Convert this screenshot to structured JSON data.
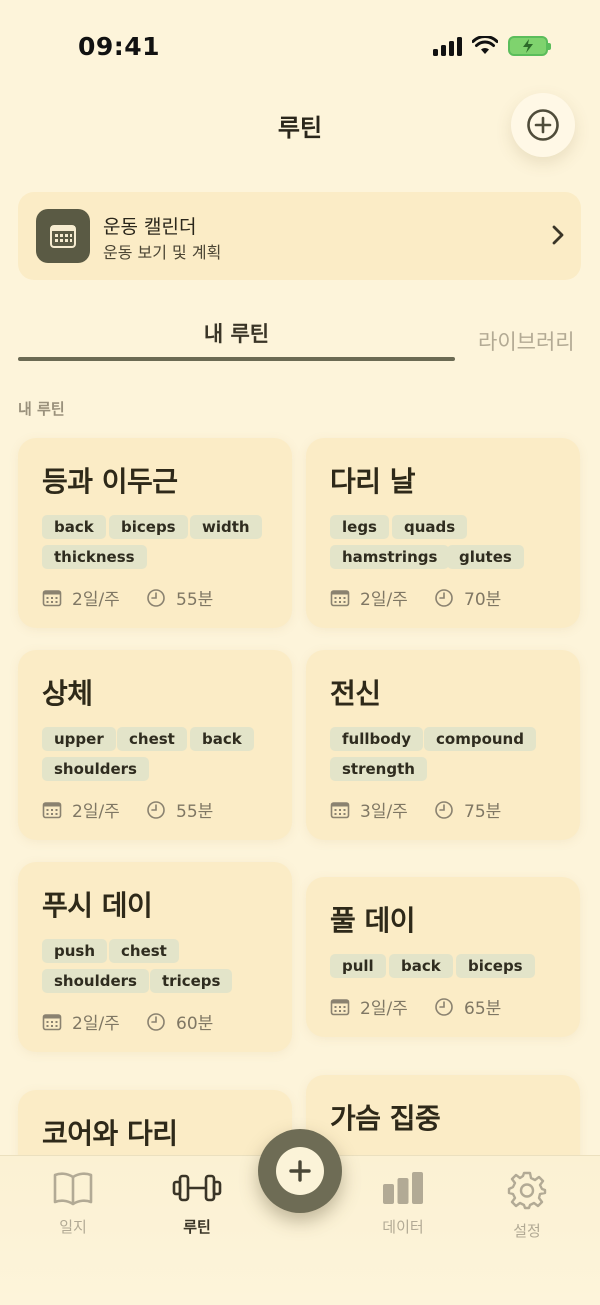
{
  "status": {
    "time": "09:41"
  },
  "header": {
    "title": "루틴"
  },
  "calendar": {
    "title": "운동 캘린더",
    "subtitle": "운동 보기 및 계획"
  },
  "tabs": [
    {
      "label": "내 루틴",
      "active": true
    },
    {
      "label": "라이브러리",
      "active": false
    }
  ],
  "section_label": "내 루틴",
  "routines": [
    {
      "title": "등과 이두근",
      "tags": [
        "back",
        "biceps",
        "width",
        "thickness"
      ],
      "frequency": "2일/주",
      "duration": "55분"
    },
    {
      "title": "다리 날",
      "tags": [
        "legs",
        "quads",
        "hamstrings",
        "glutes"
      ],
      "frequency": "2일/주",
      "duration": "70분"
    },
    {
      "title": "상체",
      "tags": [
        "upper",
        "chest",
        "back",
        "shoulders"
      ],
      "frequency": "2일/주",
      "duration": "55분"
    },
    {
      "title": "전신",
      "tags": [
        "fullbody",
        "compound",
        "strength"
      ],
      "frequency": "3일/주",
      "duration": "75분"
    },
    {
      "title": "푸시 데이",
      "tags": [
        "push",
        "chest",
        "shoulders",
        "triceps"
      ],
      "frequency": "2일/주",
      "duration": "60분"
    },
    {
      "title": "풀 데이",
      "tags": [
        "pull",
        "back",
        "biceps"
      ],
      "frequency": "2일/주",
      "duration": "65분"
    },
    {
      "title": "코어와 다리"
    },
    {
      "title": "가슴 집중"
    }
  ],
  "nav": {
    "journal": "일지",
    "routine": "루틴",
    "data": "데이터",
    "settings": "설정"
  },
  "colors": {
    "background": "#fdf4da",
    "card": "#fbecc6",
    "tag": "#e3e4c9",
    "accent": "#6e6c55"
  }
}
